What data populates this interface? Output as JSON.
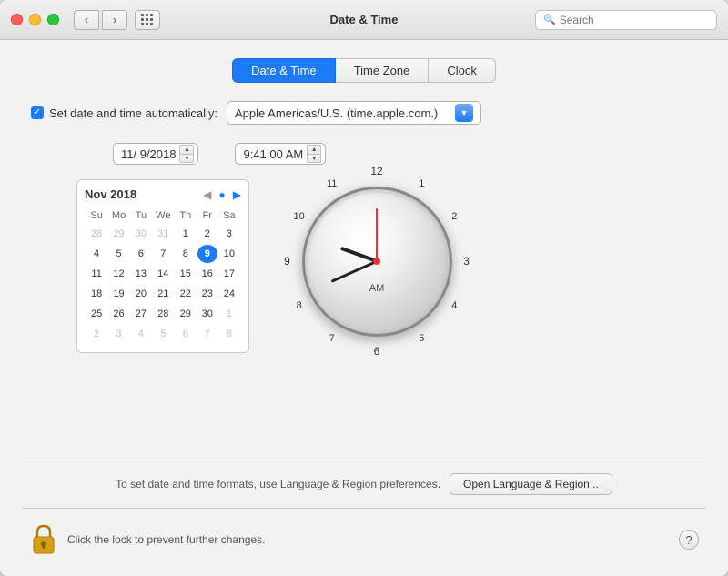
{
  "titlebar": {
    "title": "Date & Time",
    "search_placeholder": "Search"
  },
  "tabs": [
    {
      "id": "date-time",
      "label": "Date & Time",
      "active": true
    },
    {
      "id": "time-zone",
      "label": "Time Zone",
      "active": false
    },
    {
      "id": "clock",
      "label": "Clock",
      "active": false
    }
  ],
  "auto_setting": {
    "checkbox_label": "Set date and time automatically:",
    "server_value": "Apple Americas/U.S. (time.apple.com.)"
  },
  "date_display": "11/  9/2018",
  "time_display": "9:41:00 AM",
  "calendar": {
    "month_year": "Nov 2018",
    "day_headers": [
      "Su",
      "Mo",
      "Tu",
      "We",
      "Th",
      "Fr",
      "Sa"
    ],
    "weeks": [
      [
        "28",
        "29",
        "30",
        "31",
        "1",
        "2",
        "3"
      ],
      [
        "4",
        "5",
        "6",
        "7",
        "8",
        "9",
        "10"
      ],
      [
        "11",
        "12",
        "13",
        "14",
        "15",
        "16",
        "17"
      ],
      [
        "18",
        "19",
        "20",
        "21",
        "22",
        "23",
        "24"
      ],
      [
        "25",
        "26",
        "27",
        "28",
        "29",
        "30",
        "1"
      ],
      [
        "2",
        "3",
        "4",
        "5",
        "6",
        "7",
        "8"
      ]
    ],
    "other_month_days": [
      "28",
      "29",
      "30",
      "31",
      "1",
      "2",
      "3",
      "1",
      "2",
      "3",
      "4",
      "5",
      "6",
      "7",
      "8"
    ],
    "today": "9"
  },
  "clock": {
    "am_pm": "AM",
    "numbers": [
      {
        "n": "12",
        "angle": 0
      },
      {
        "n": "1",
        "angle": 30
      },
      {
        "n": "2",
        "angle": 60
      },
      {
        "n": "3",
        "angle": 90
      },
      {
        "n": "4",
        "angle": 120
      },
      {
        "n": "5",
        "angle": 150
      },
      {
        "n": "6",
        "angle": 180
      },
      {
        "n": "7",
        "angle": 210
      },
      {
        "n": "8",
        "angle": 240
      },
      {
        "n": "9",
        "angle": 270
      },
      {
        "n": "10",
        "angle": 300
      },
      {
        "n": "11",
        "angle": 330
      }
    ]
  },
  "bottom": {
    "region_text": "To set date and time formats, use Language & Region preferences.",
    "region_btn": "Open Language & Region...",
    "lock_text": "Click the lock to prevent further changes."
  }
}
